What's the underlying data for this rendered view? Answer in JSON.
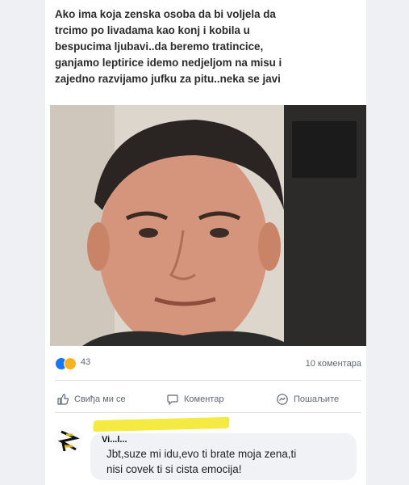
{
  "post": {
    "text": "Ako ima koja zenska osoba da bi voljela da\ntrcimo po livadama kao konj i kobila u\nbespucima ljubavi..da beremo tratincice,\nganjamo leptirice idemo nedjeljom na misu i\nzajedno razvijamo jufku za pitu..neka se javi",
    "photo_alt": "selfie of a smiling man"
  },
  "reactions": {
    "count": "43",
    "icons": [
      "like-icon",
      "haha-icon"
    ],
    "comments": "10 коментара"
  },
  "actions": {
    "like": "Свиђа ми се",
    "comment": "Коментар",
    "share": "Пошаљите"
  },
  "comment": {
    "author": "Vi...l...",
    "text": "Jbt,suze mi idu,evo ti brate moja zena,ti\nnisi covek ti si cista emocija!"
  },
  "colors": {
    "like_blue": "#1877f2",
    "haha_yellow": "#f7b125",
    "highlight": "#f4ea42",
    "bubble": "#f0f2f5"
  }
}
